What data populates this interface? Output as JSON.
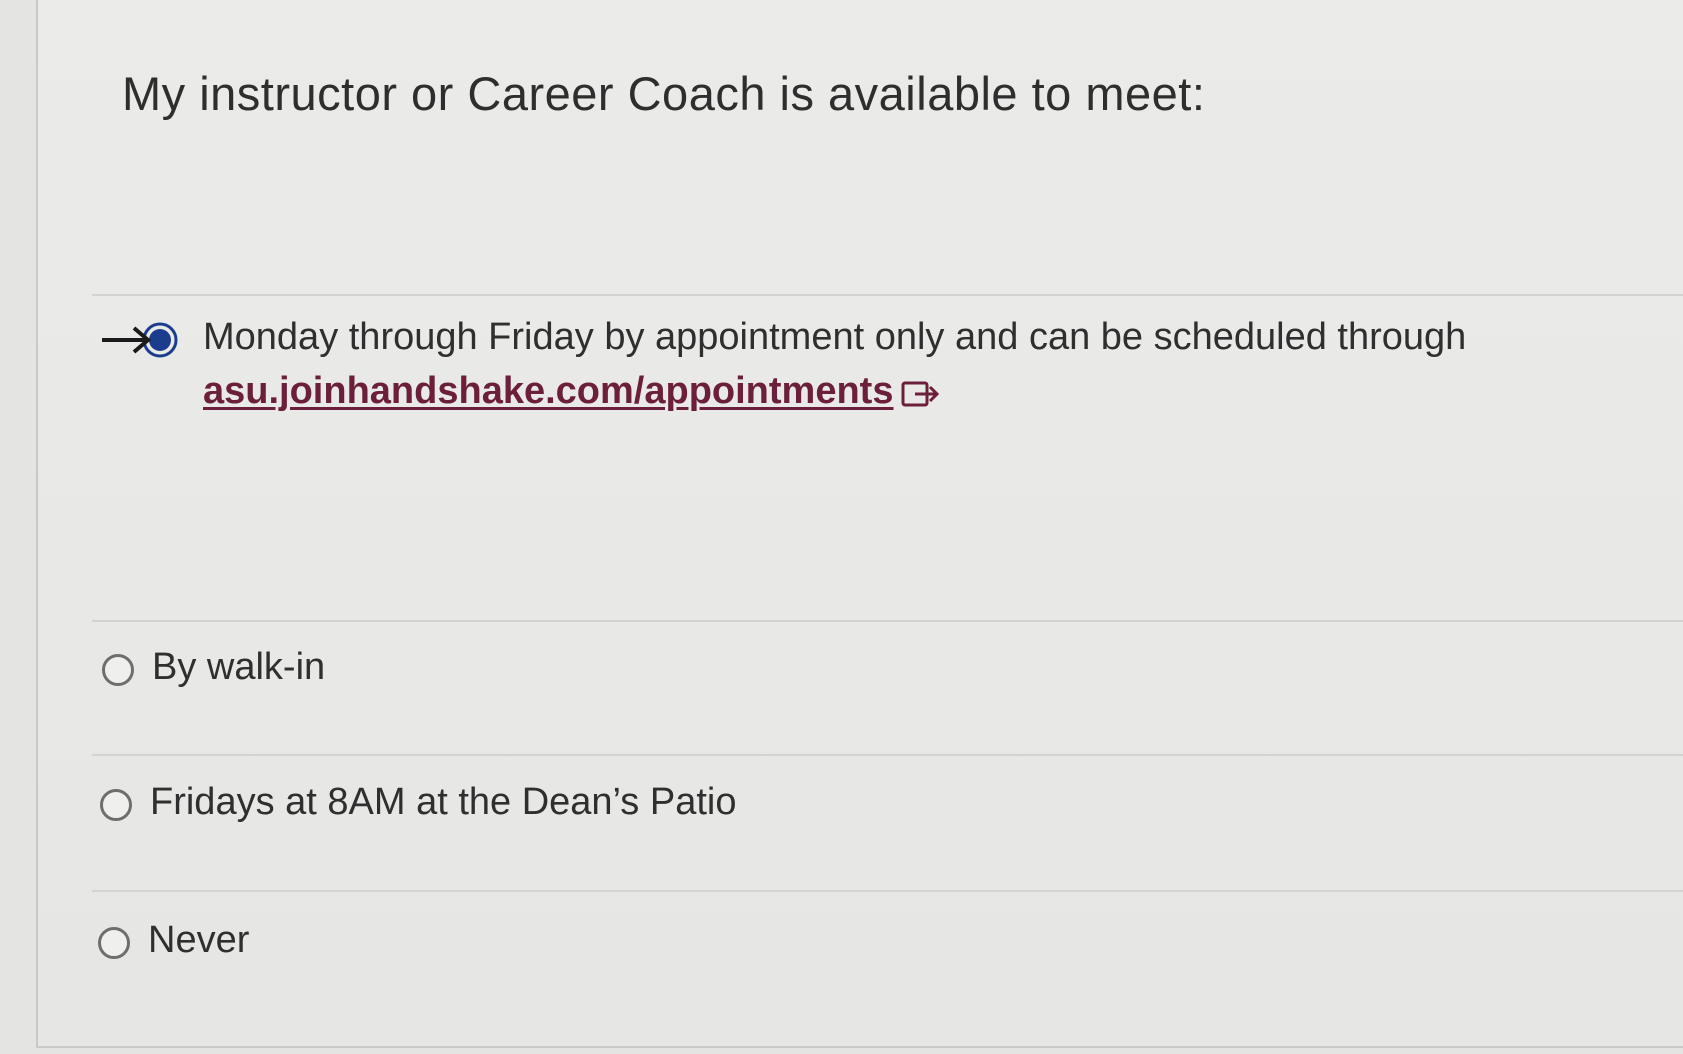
{
  "question": {
    "prompt": "My instructor or Career Coach is available to meet:"
  },
  "answers": [
    {
      "text": "Monday through Friday by appointment only and can be scheduled through",
      "link_text": "asu.joinhandshake.com/appointments",
      "marked_correct": true
    },
    {
      "text": "By walk-in",
      "marked_correct": false
    },
    {
      "text": "Fridays at 8AM at the Dean’s Patio",
      "marked_correct": false
    },
    {
      "text": "Never",
      "marked_correct": false
    }
  ],
  "icons": {
    "correct_marker": "correct-answer-arrow-icon",
    "external_link": "external-link-icon"
  },
  "colors": {
    "link": "#6b1f3a",
    "correct_marker": "#1c3c8c"
  }
}
